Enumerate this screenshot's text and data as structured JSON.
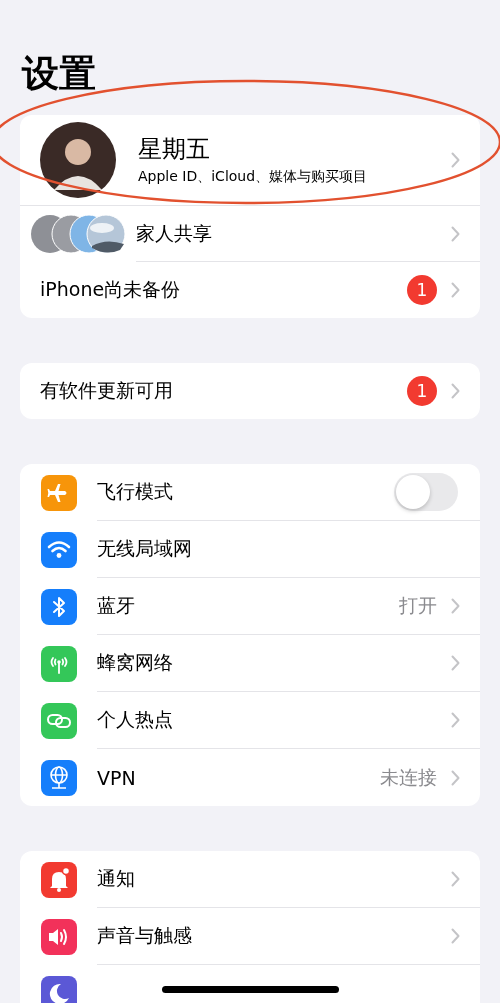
{
  "title": "设置",
  "account": {
    "name": "星期五",
    "subtitle": "Apple ID、iCloud、媒体与购买项目"
  },
  "account_rows": [
    {
      "label": "家人共享",
      "badge": null,
      "kind": "family"
    },
    {
      "label": "iPhone尚未备份",
      "badge": "1",
      "kind": "plain"
    }
  ],
  "update_row": {
    "label": "有软件更新可用",
    "badge": "1"
  },
  "network_rows": [
    {
      "label": "飞行模式",
      "kind": "toggle",
      "on": false,
      "color": "#f7950a"
    },
    {
      "label": "无线局域网",
      "kind": "bare",
      "color": "#157efb"
    },
    {
      "label": "蓝牙",
      "kind": "link",
      "value": "打开",
      "color": "#157efb"
    },
    {
      "label": "蜂窝网络",
      "kind": "link",
      "color": "#34c759"
    },
    {
      "label": "个人热点",
      "kind": "link",
      "color": "#34c759"
    },
    {
      "label": "VPN",
      "kind": "link",
      "value": "未连接",
      "color": "#157efb"
    }
  ],
  "general_rows": [
    {
      "label": "通知",
      "kind": "link",
      "color": "#f23a30"
    },
    {
      "label": "声音与触感",
      "kind": "link",
      "color": "#f2315a"
    },
    {
      "kind": "cut",
      "color": "#5b58d6"
    }
  ]
}
